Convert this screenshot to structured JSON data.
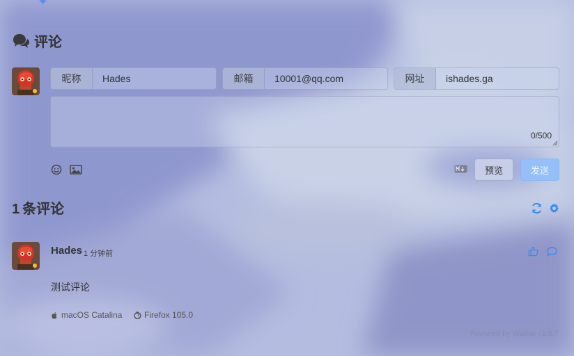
{
  "comments_section": {
    "title": "评论",
    "form": {
      "nick_label": "昵称",
      "nick_value": "Hades",
      "mail_label": "邮箱",
      "mail_value": "10001@qq.com",
      "link_label": "网址",
      "link_value": "ishades.ga",
      "word_count": "0/500",
      "preview_label": "预览",
      "send_label": "发送"
    },
    "count_number": "1",
    "count_label": "条评论",
    "comment": {
      "author": "Hades",
      "time": "1 分钟前",
      "text": "测试评论",
      "os": "macOS Catalina",
      "browser": "Firefox 105.0"
    },
    "footer": {
      "powered_by": "Powered by",
      "brand": "Waline",
      "version": "v1.6.7"
    }
  },
  "icons": {
    "section": "comments-icon",
    "emoji": "emoji-icon",
    "image": "image-icon",
    "markdown": "markdown-icon",
    "refresh": "refresh-icon",
    "settings": "gear-icon",
    "like": "thumbs-up-icon",
    "reply": "reply-icon",
    "os": "apple-icon",
    "browser": "firefox-icon"
  },
  "colors": {
    "accent": "#3a8af0",
    "send_button": "#94bff8",
    "background": "#b9c2e2"
  }
}
